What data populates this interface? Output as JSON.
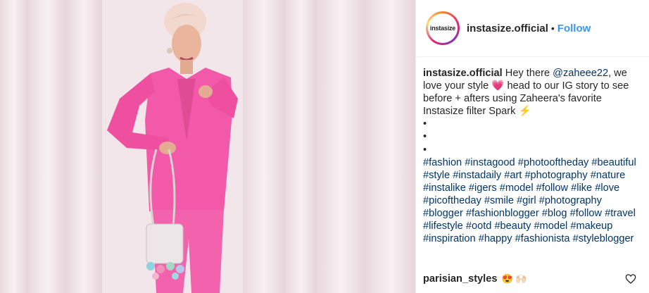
{
  "header": {
    "avatar_text": "instasize",
    "username": "instasize.official",
    "separator": "•",
    "follow_label": "Follow"
  },
  "caption": {
    "username": "instasize.official",
    "text_before_mention": "Hey there",
    "mention": "@zaheee22",
    "text_after_mention": ", we love your style 💗  head to our IG story to see before + afters using Zaheera's favorite Instasize filter Spark ⚡",
    "bullets": [
      "•",
      "•",
      "•"
    ],
    "hashtags": [
      "#fashion",
      "#instagood",
      "#photooftheday",
      "#beautiful",
      "#style",
      "#instadaily",
      "#art",
      "#photography",
      "#nature",
      "#instalike",
      "#igers",
      "#model",
      "#follow",
      "#like",
      "#love",
      "#picoftheday",
      "#smile",
      "#girl",
      "#photography",
      "#blogger",
      "#fashionblogger",
      "#blog",
      "#follow",
      "#travel",
      "#lifestyle",
      "#ootd",
      "#beauty",
      "#model",
      "#makeup",
      "#inspiration",
      "#happy",
      "#fashionista",
      "#styleblogger"
    ]
  },
  "comment": {
    "username": "parisian_styles",
    "emoji": "😍 🙌🏻"
  },
  "colors": {
    "link": "#003569",
    "follow": "#3897f0",
    "suit": "#f25aa9",
    "wall": "#f3e8eb"
  }
}
